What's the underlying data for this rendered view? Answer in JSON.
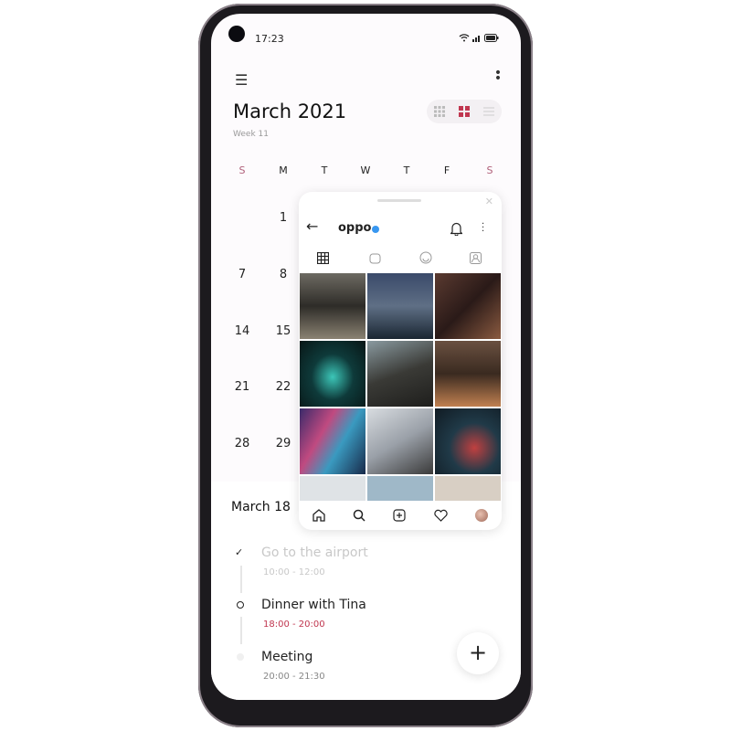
{
  "status_bar": {
    "time": "17:23"
  },
  "calendar": {
    "title": "March 2021",
    "subtitle": "Week 11",
    "weekdays": [
      "S",
      "M",
      "T",
      "W",
      "T",
      "F",
      "S"
    ],
    "visible_dates": {
      "sunday": [
        "7",
        "14",
        "21",
        "28"
      ],
      "monday": [
        "1",
        "8",
        "15",
        "22",
        "29"
      ]
    },
    "accent": "#c0364f"
  },
  "agenda": {
    "date": "March 18",
    "tasks": [
      {
        "title": "Go to the airport",
        "time": "10:00 - 12:00",
        "state": "done"
      },
      {
        "title": "Dinner with Tina",
        "time": "18:00 - 20:00",
        "state": "current"
      },
      {
        "title": "Meeting",
        "time": "20:00 - 21:30",
        "state": "upcoming"
      }
    ]
  },
  "floating_window": {
    "account": "oppo",
    "verified": true,
    "tabs": [
      "grid",
      "igtv",
      "tagged-effects",
      "tagged"
    ],
    "nav": [
      "home",
      "search",
      "add",
      "activity",
      "profile"
    ]
  },
  "fab_label": "+"
}
